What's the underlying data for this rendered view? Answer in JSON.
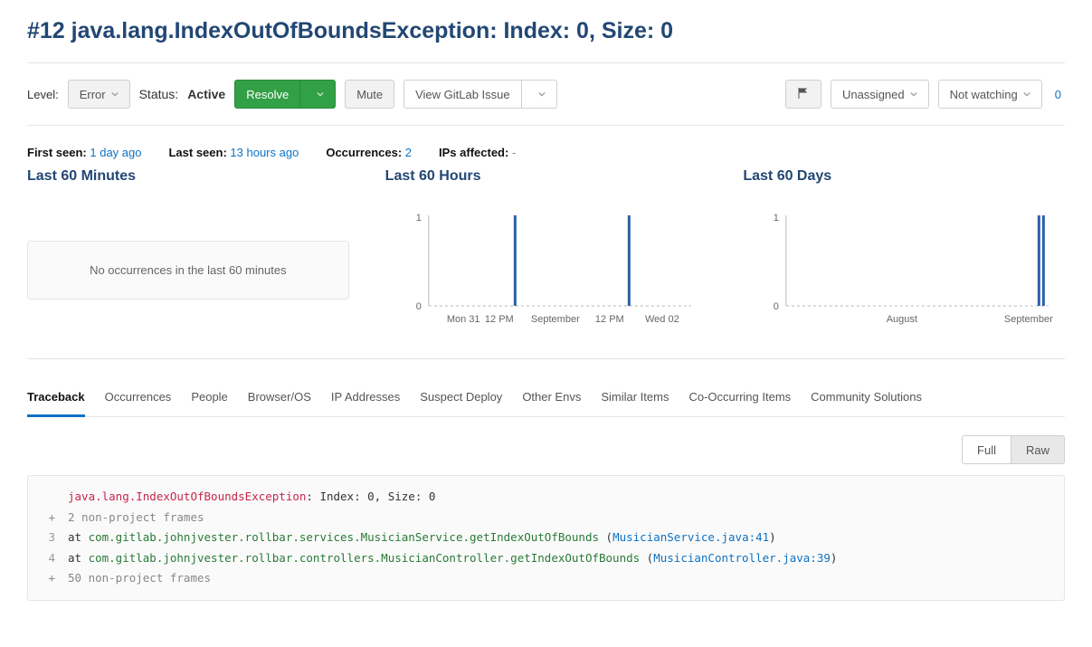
{
  "title": "#12 java.lang.IndexOutOfBoundsException: Index: 0, Size: 0",
  "toolbar": {
    "level_label": "Level:",
    "level_value": "Error",
    "status_label": "Status:",
    "status_value": "Active",
    "resolve": "Resolve",
    "mute": "Mute",
    "view_issue": "View GitLab Issue",
    "assigned": "Unassigned",
    "watching": "Not watching",
    "watch_count": "0"
  },
  "stats": {
    "first_seen_label": "First seen:",
    "first_seen_value": "1 day ago",
    "last_seen_label": "Last seen:",
    "last_seen_value": "13 hours ago",
    "occurrences_label": "Occurrences:",
    "occurrences_value": "2",
    "ips_label": "IPs affected:",
    "ips_value": "-"
  },
  "chart_data": [
    {
      "title": "Last 60 Minutes",
      "type": "bar",
      "empty": true,
      "empty_message": "No occurrences in the last 60 minutes"
    },
    {
      "title": "Last 60 Hours",
      "type": "bar",
      "ylim": [
        0,
        1
      ],
      "yticks": [
        0,
        1
      ],
      "x_categories": [
        "Mon 31",
        "12 PM",
        "September",
        "12 PM",
        "Wed 02"
      ],
      "bars": [
        {
          "x_frac": 0.33,
          "value": 1
        },
        {
          "x_frac": 0.76,
          "value": 1
        }
      ]
    },
    {
      "title": "Last 60 Days",
      "type": "bar",
      "ylim": [
        0,
        1
      ],
      "yticks": [
        0,
        1
      ],
      "x_categories": [
        "August",
        "September"
      ],
      "bars": [
        {
          "x_frac": 0.975,
          "value": 1
        },
        {
          "x_frac": 0.99,
          "value": 1
        }
      ]
    }
  ],
  "tabs": [
    "Traceback",
    "Occurrences",
    "People",
    "Browser/OS",
    "IP Addresses",
    "Suspect Deploy",
    "Other Envs",
    "Similar Items",
    "Co-Occurring Items",
    "Community Solutions"
  ],
  "active_tab": "Traceback",
  "view_toggle": {
    "full": "Full",
    "raw": "Raw",
    "active": "Raw"
  },
  "traceback": {
    "exception_class": "java.lang.IndexOutOfBoundsException",
    "exception_msg": ": Index: 0, Size: 0",
    "rows": [
      {
        "gutter": "+",
        "muted": "2 non-project frames"
      },
      {
        "gutter": "3",
        "prefix": "at ",
        "call": "com.gitlab.johnjvester.rollbar.services.MusicianService.getIndexOutOfBounds",
        "loc": "MusicianService.java:41"
      },
      {
        "gutter": "4",
        "prefix": "at ",
        "call": "com.gitlab.johnjvester.rollbar.controllers.MusicianController.getIndexOutOfBounds",
        "loc": "MusicianController.java:39"
      },
      {
        "gutter": "+",
        "muted": "50 non-project frames"
      }
    ]
  }
}
